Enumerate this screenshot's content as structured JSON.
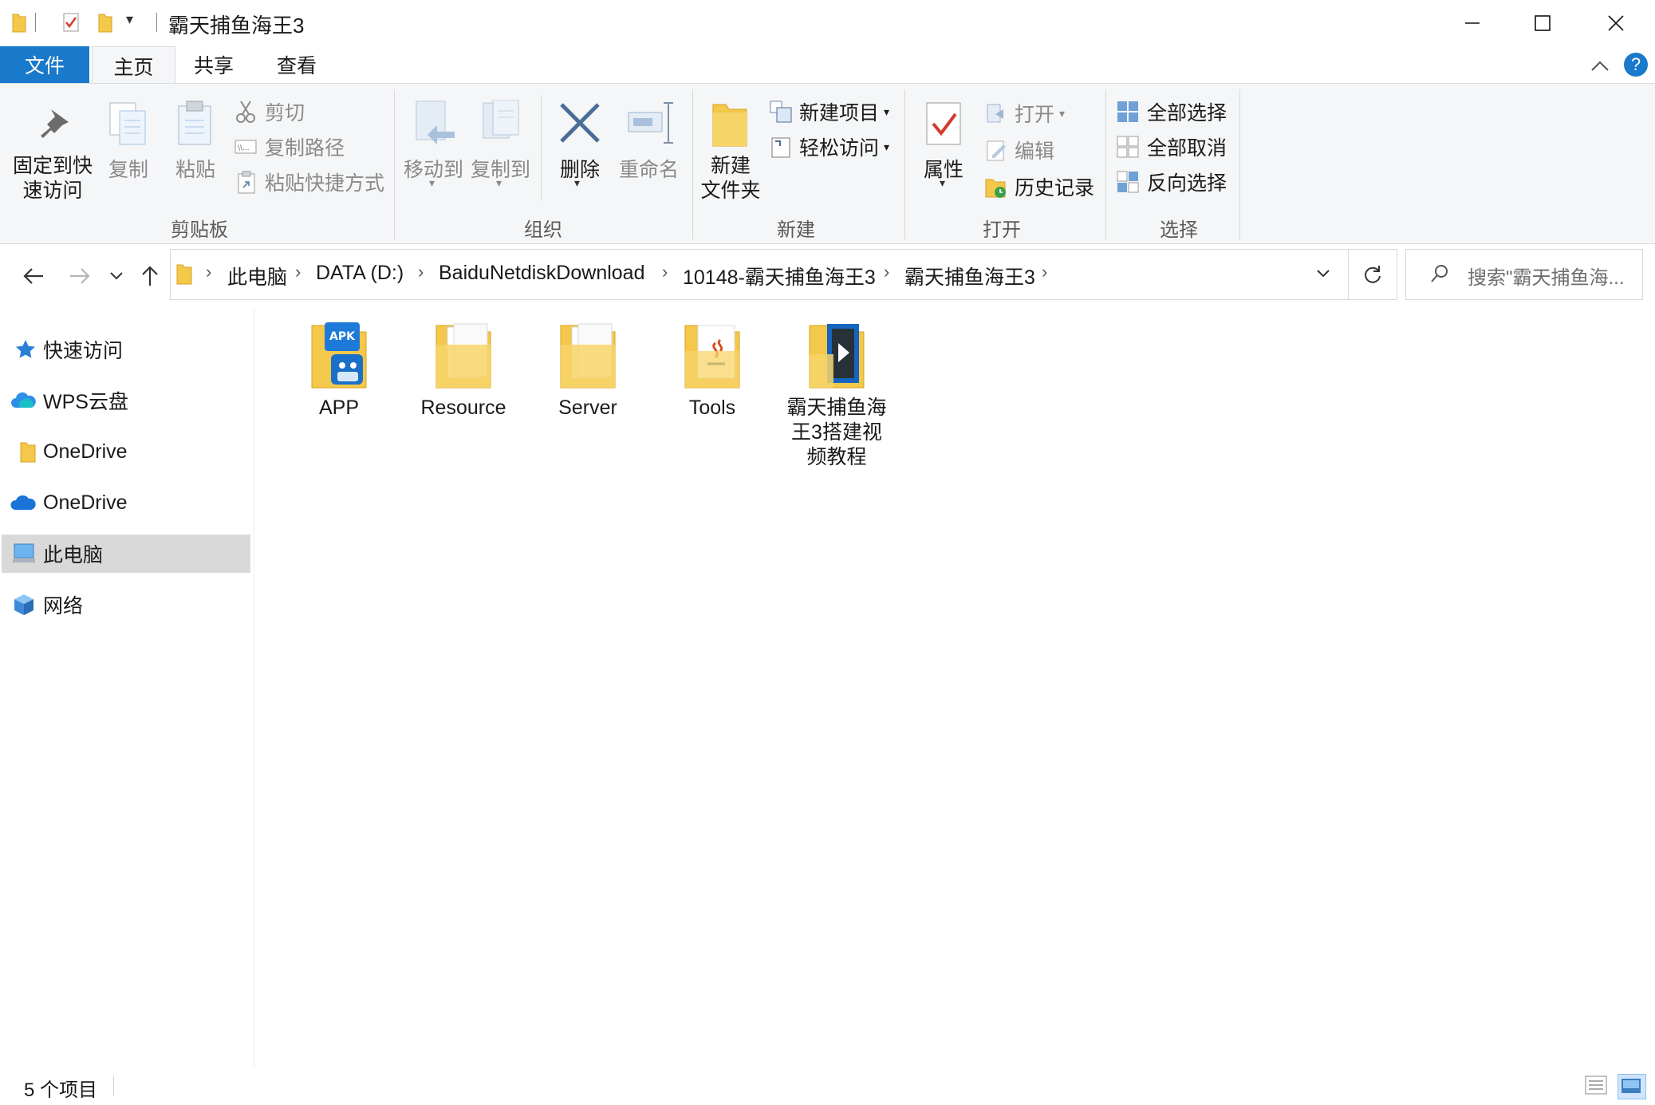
{
  "window": {
    "title": "霸天捕鱼海王3"
  },
  "ribbon_tabs": {
    "file": "文件",
    "home": "主页",
    "share": "共享",
    "view": "查看"
  },
  "ribbon": {
    "clipboard": {
      "pin_line1": "固定到快",
      "pin_line2": "速访问",
      "copy": "复制",
      "paste": "粘贴",
      "cut": "剪切",
      "copy_path": "复制路径",
      "paste_shortcut": "粘贴快捷方式",
      "group_label": "剪贴板"
    },
    "organize": {
      "move_to": "移动到",
      "copy_to": "复制到",
      "delete": "删除",
      "rename": "重命名",
      "group_label": "组织"
    },
    "new": {
      "new_folder_line1": "新建",
      "new_folder_line2": "文件夹",
      "new_item": "新建项目",
      "easy_access": "轻松访问",
      "group_label": "新建"
    },
    "open": {
      "properties": "属性",
      "open": "打开",
      "edit": "编辑",
      "history": "历史记录",
      "group_label": "打开"
    },
    "select": {
      "select_all": "全部选择",
      "select_none": "全部取消",
      "invert": "反向选择",
      "group_label": "选择"
    }
  },
  "address": {
    "crumbs": [
      "此电脑",
      "DATA (D:)",
      "BaiduNetdiskDownload",
      "10148-霸天捕鱼海王3",
      "霸天捕鱼海王3"
    ],
    "search_placeholder": "搜索\"霸天捕鱼海..."
  },
  "nav_pane": {
    "items": [
      {
        "label": "快速访问",
        "icon": "star-icon",
        "selected": false
      },
      {
        "label": "WPS云盘",
        "icon": "cloud-icon",
        "selected": false
      },
      {
        "label": "OneDrive",
        "icon": "folder-icon",
        "selected": false
      },
      {
        "label": "OneDrive",
        "icon": "cloud-icon",
        "selected": false
      },
      {
        "label": "此电脑",
        "icon": "computer-icon",
        "selected": true
      },
      {
        "label": "网络",
        "icon": "network-icon",
        "selected": false
      }
    ]
  },
  "files": [
    {
      "name": "APP",
      "icon": "apk-folder-icon"
    },
    {
      "name": "Resource",
      "icon": "folder-icon"
    },
    {
      "name": "Server",
      "icon": "folder-icon"
    },
    {
      "name": "Tools",
      "icon": "java-folder-icon"
    },
    {
      "name": "霸天捕鱼海王3搭建视频教程",
      "icon": "video-folder-icon"
    }
  ],
  "status": {
    "item_count": "5 个项目"
  },
  "colors": {
    "accent": "#1979ca",
    "folder": "#f3c84b",
    "selection": "#d9d9d9"
  }
}
